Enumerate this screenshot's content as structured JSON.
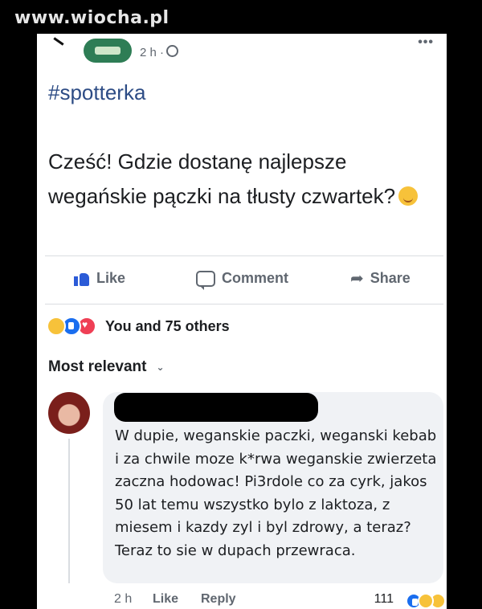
{
  "watermark": "www.wiocha.pl",
  "post": {
    "time": "2 h ·",
    "more": "•••",
    "hashtag": "#spotterka",
    "text": "Cześć! Gdzie dostanę najlepsze wegańskie pączki na tłusty czwartek?"
  },
  "actions": {
    "like": "Like",
    "comment": "Comment",
    "share": "Share"
  },
  "reactions": {
    "summary": "You and 75 others"
  },
  "comments": {
    "sort_label": "Most relevant",
    "items": [
      {
        "text": "W dupie, weganskie paczki, weganski kebab i za chwile moze k*rwa weganskie zwierzeta zaczna hodowac! Pi3rdole co za cyrk, jakos 50 lat temu wszystko bylo z laktoza, z miesem i kazdy zyl i byl zdrowy, a teraz? Teraz to sie w dupach przewraca.",
        "time": "2 h",
        "like": "Like",
        "reply": "Reply",
        "reaction_count": "111"
      }
    ]
  },
  "colors": {
    "hashtag": "#2d4c85",
    "like_blue": "#2b5bd7",
    "text": "#1c1e21",
    "muted": "#606770",
    "bubble": "#f0f2f5"
  }
}
